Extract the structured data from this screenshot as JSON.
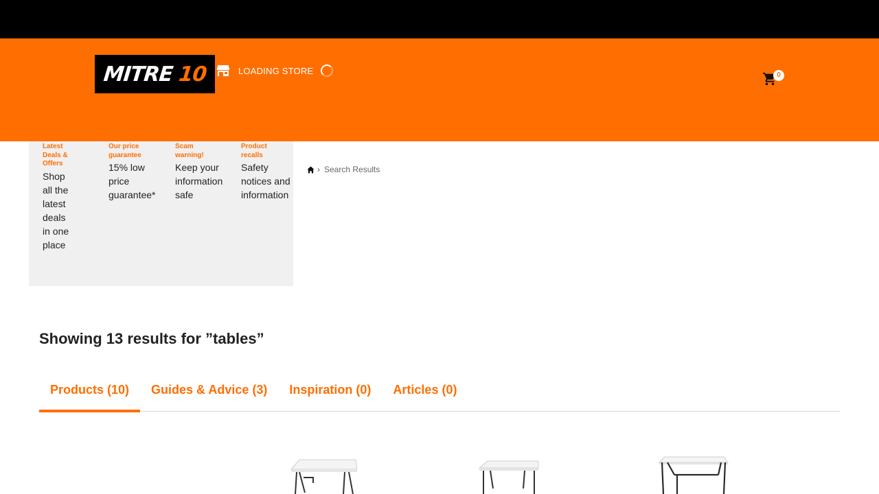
{
  "header": {
    "logo_text": "MITRE",
    "logo_number": "10",
    "store_label": "LOADING STORE",
    "cart_count": "0",
    "colors": {
      "brand": "#ff6e00",
      "topbar": "#000000"
    }
  },
  "promos": [
    {
      "title": "Latest Deals & Offers",
      "description": "Shop all the latest deals in one place"
    },
    {
      "title": "Our price guarantee",
      "description": "15% low price guarantee*"
    },
    {
      "title": "Scam warning!",
      "description": "Keep your information safe"
    },
    {
      "title": "Product recalls",
      "description": "Safety notices and information"
    }
  ],
  "breadcrumb": {
    "home_icon": "home-icon",
    "current": "Search Results"
  },
  "results": {
    "title": "Showing 13 results for ”tables”"
  },
  "tabs": [
    {
      "label": "Products (10)",
      "active": true
    },
    {
      "label": "Guides & Advice (3)",
      "active": false
    },
    {
      "label": "Inspiration (0)",
      "active": false
    },
    {
      "label": "Articles (0)",
      "active": false
    }
  ],
  "products": [
    {
      "image": "folding-table-image"
    },
    {
      "image": "folding-table-image"
    },
    {
      "image": "folding-table-image"
    }
  ]
}
